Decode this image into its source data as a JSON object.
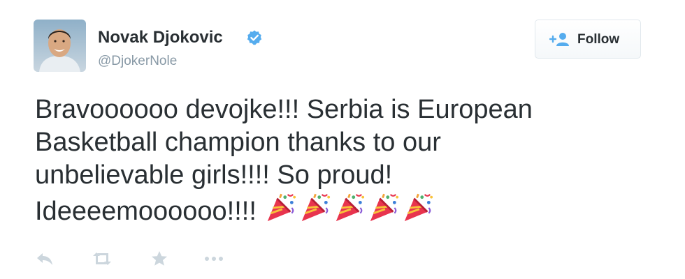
{
  "author": {
    "name": "Novak Djokovic",
    "handle": "@DjokerNole",
    "verified": true,
    "avatar_icon": "profile-photo"
  },
  "follow_button": {
    "label": "Follow",
    "icon": "add-user-icon"
  },
  "tweet": {
    "lines": [
      "Bravoooooo devojke!!! Serbia is European",
      "Basketball champion thanks to our",
      "unbelievable girls!!!! So proud!",
      "Ideeeemoooooo!!!!"
    ],
    "emoji": "party-popper-icon",
    "emoji_count": 5
  },
  "actions": [
    {
      "name": "reply-icon"
    },
    {
      "name": "retweet-icon"
    },
    {
      "name": "favorite-icon"
    },
    {
      "name": "more-icon"
    }
  ],
  "colors": {
    "text": "#292f33",
    "muted": "#8899a6",
    "verified": "#55acee",
    "action_icon": "#ccd6dd",
    "border": "#e1e8ed"
  }
}
